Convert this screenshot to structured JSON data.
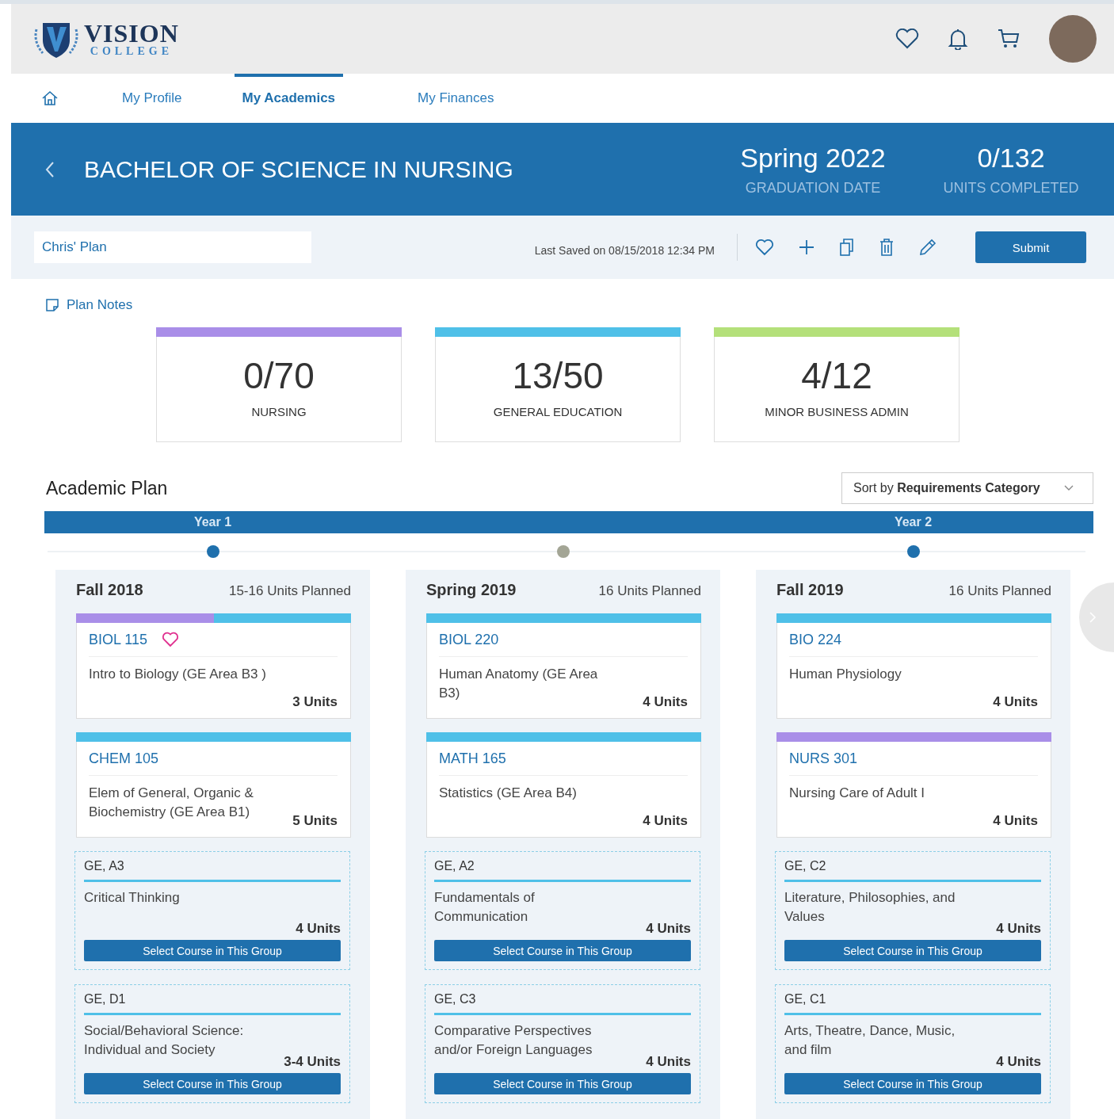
{
  "logo": {
    "name": "VISION",
    "subtitle": "COLLEGE"
  },
  "nav": {
    "tabs": [
      {
        "label": "My Profile",
        "selected": false
      },
      {
        "label": "My Academics",
        "selected": true
      },
      {
        "label": "My Finances",
        "selected": false
      }
    ]
  },
  "banner": {
    "title": "BACHELOR OF SCIENCE IN NURSING",
    "stats": [
      {
        "value": "Spring 2022",
        "label": "GRADUATION DATE"
      },
      {
        "value": "0/132",
        "label": "UNITS COMPLETED"
      }
    ]
  },
  "toolbar": {
    "plan_name": "Chris' Plan",
    "last_saved": "Last Saved on 08/15/2018 12:34 PM",
    "submit": "Submit"
  },
  "plan_notes": "Plan Notes",
  "progress": [
    {
      "value": "0/70",
      "label": "NURSING",
      "color": "#a98ee8"
    },
    {
      "value": "13/50",
      "label": "GENERAL EDUCATION",
      "color": "#4fc0e8"
    },
    {
      "value": "4/12",
      "label": "MINOR BUSINESS ADMIN",
      "color": "#b4e07a"
    }
  ],
  "academic_plan": {
    "title": "Academic Plan",
    "sort_prefix": "Sort by",
    "sort_value": "Requirements Category",
    "terms": [
      {
        "year": "Year 1",
        "name": "Fall 2018",
        "units_planned": "15-16 Units Planned",
        "dot": {
          "color": "#1f70ad"
        },
        "courses": [
          {
            "kind": "course",
            "code": "BIOL 115",
            "title": "Intro to Biology (GE Area B3 )",
            "units": "3 Units",
            "bars": [
              {
                "color": "#a98ee8"
              },
              {
                "color": "#4fc0e8"
              }
            ],
            "favorite": true
          },
          {
            "kind": "course",
            "code": "CHEM 105",
            "title": "Elem of General, Organic & Biochemistry (GE Area B1)",
            "units": "5 Units",
            "bars": [
              {
                "color": "#4fc0e8"
              }
            ],
            "favorite": false
          },
          {
            "kind": "group",
            "code": "GE, A3",
            "title": "Critical Thinking",
            "units": "4 Units",
            "button": "Select Course in This Group"
          },
          {
            "kind": "group",
            "code": "GE, D1",
            "title": "Social/Behavioral Science: Individual and Society",
            "units": "3-4 Units",
            "button": "Select Course in This Group"
          }
        ]
      },
      {
        "name": "Spring 2019",
        "units_planned": "16 Units Planned",
        "dot": {
          "color": "#a3a595"
        },
        "courses": [
          {
            "kind": "course",
            "code": "BIOL 220",
            "title": "Human Anatomy (GE Area B3)",
            "units": "4 Units",
            "bars": [
              {
                "color": "#4fc0e8"
              }
            ],
            "favorite": false
          },
          {
            "kind": "course",
            "code": "MATH 165",
            "title": "Statistics (GE Area B4)",
            "units": "4 Units",
            "bars": [
              {
                "color": "#4fc0e8"
              }
            ],
            "favorite": false
          },
          {
            "kind": "group",
            "code": "GE, A2",
            "title": "Fundamentals of Communication",
            "units": "4 Units",
            "button": "Select Course in This Group"
          },
          {
            "kind": "group",
            "code": "GE, C3",
            "title": "Comparative Perspectives and/or Foreign Languages",
            "units": "4 Units",
            "button": "Select Course in This Group"
          }
        ]
      },
      {
        "year": "Year 2",
        "name": "Fall 2019",
        "units_planned": "16 Units Planned",
        "dot": {
          "color": "#1f70ad"
        },
        "courses": [
          {
            "kind": "course",
            "code": "BIO 224",
            "title": "Human Physiology",
            "units": "4 Units",
            "bars": [
              {
                "color": "#4fc0e8"
              }
            ],
            "favorite": false
          },
          {
            "kind": "course",
            "code": "NURS 301",
            "title": "Nursing Care of Adult I",
            "units": "4 Units",
            "bars": [
              {
                "color": "#a98ee8"
              }
            ],
            "favorite": false
          },
          {
            "kind": "group",
            "code": "GE, C2",
            "title": "Literature, Philosophies, and Values",
            "units": "4 Units",
            "button": "Select Course in This Group"
          },
          {
            "kind": "group",
            "code": "GE, C1",
            "title": "Arts, Theatre, Dance, Music, and film",
            "units": "4 Units",
            "button": "Select Course in This Group"
          }
        ]
      }
    ]
  }
}
